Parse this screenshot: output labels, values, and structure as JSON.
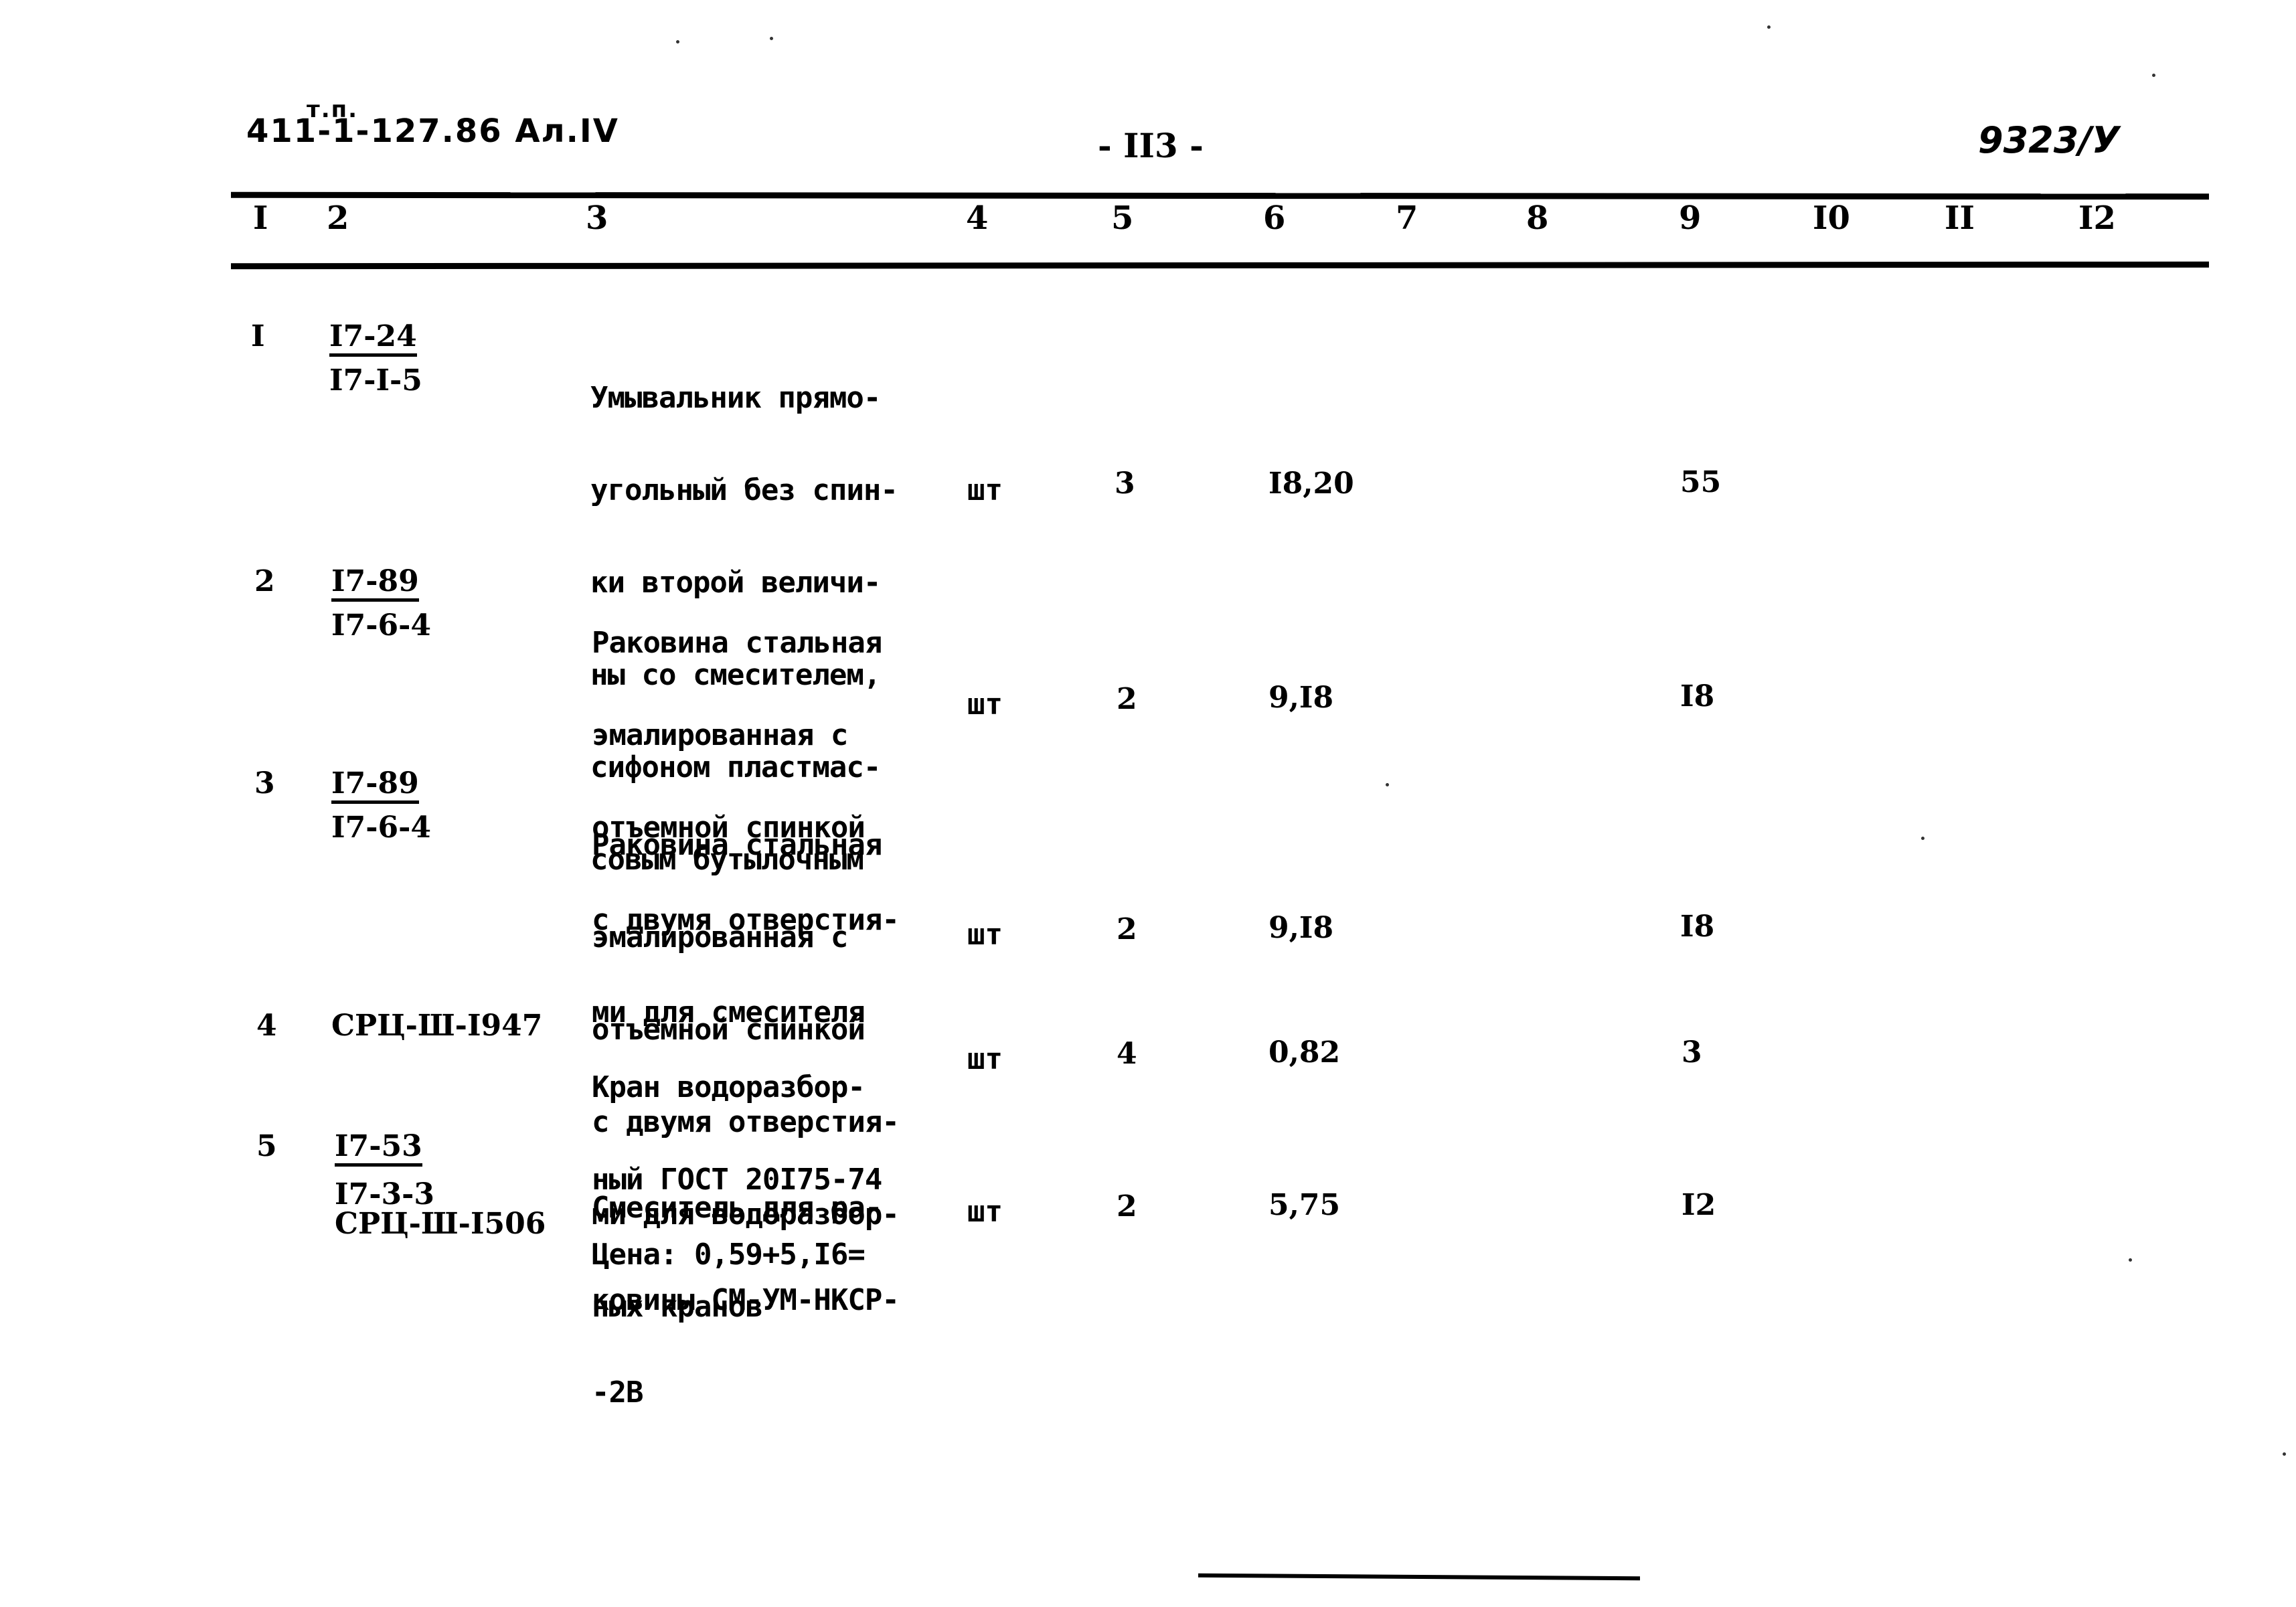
{
  "header": {
    "doc_code_prefix": "т.п.",
    "doc_code": "411-1-127.86 Ал.IV",
    "page_number": "- II3 -",
    "inventory_number": "9323/У"
  },
  "columns": [
    "I",
    "2",
    "3",
    "4",
    "5",
    "6",
    "7",
    "8",
    "9",
    "I0",
    "II",
    "I2"
  ],
  "rows": [
    {
      "num": "I",
      "ref_top": "I7-24",
      "ref_bottom": [
        "I7-I-5"
      ],
      "description": [
        "Умывальник прямо-",
        "угольный без спин-",
        "ки второй величи-",
        "ны со смесителем,",
        "сифоном пластмас-",
        "совым бутылочным"
      ],
      "unit": "шт",
      "qty": "3",
      "col6": "I8,20",
      "col9": "55"
    },
    {
      "num": "2",
      "ref_top": "I7-89",
      "ref_bottom": [
        "I7-6-4"
      ],
      "description": [
        "Раковина стальная",
        "эмалированная с",
        "отъемной спинкой",
        "с двумя отверстия-",
        "ми для смесителя"
      ],
      "unit": "шт",
      "qty": "2",
      "col6": "9,I8",
      "col9": "I8"
    },
    {
      "num": "3",
      "ref_top": "I7-89",
      "ref_bottom": [
        "I7-6-4"
      ],
      "description": [
        "Раковина стальная",
        "эмалированная с",
        "отъемной спинкой",
        "с двумя отверстия-",
        "ми для водоразбор-",
        "ных кранов"
      ],
      "unit": "шт",
      "qty": "2",
      "col6": "9,I8",
      "col9": "I8"
    },
    {
      "num": "4",
      "ref_top": "СРЦ-Ш-I947",
      "ref_bottom": [],
      "description": [
        "Кран водоразбор-",
        "ный ГОСТ 20I75-74"
      ],
      "unit": "шт",
      "qty": "4",
      "col6": "0,82",
      "col9": "3"
    },
    {
      "num": "5",
      "ref_top": "I7-53",
      "ref_bottom": [
        "I7-3-3",
        "СРЦ-Ш-I506"
      ],
      "description": [
        "Смеситель для ра-",
        "ковины СМ-УМ-НКСР-",
        "-2В"
      ],
      "price_note": "Цена: 0,59+5,I6=",
      "unit": "шт",
      "qty": "2",
      "col6": "5,75",
      "col9": "I2"
    }
  ]
}
